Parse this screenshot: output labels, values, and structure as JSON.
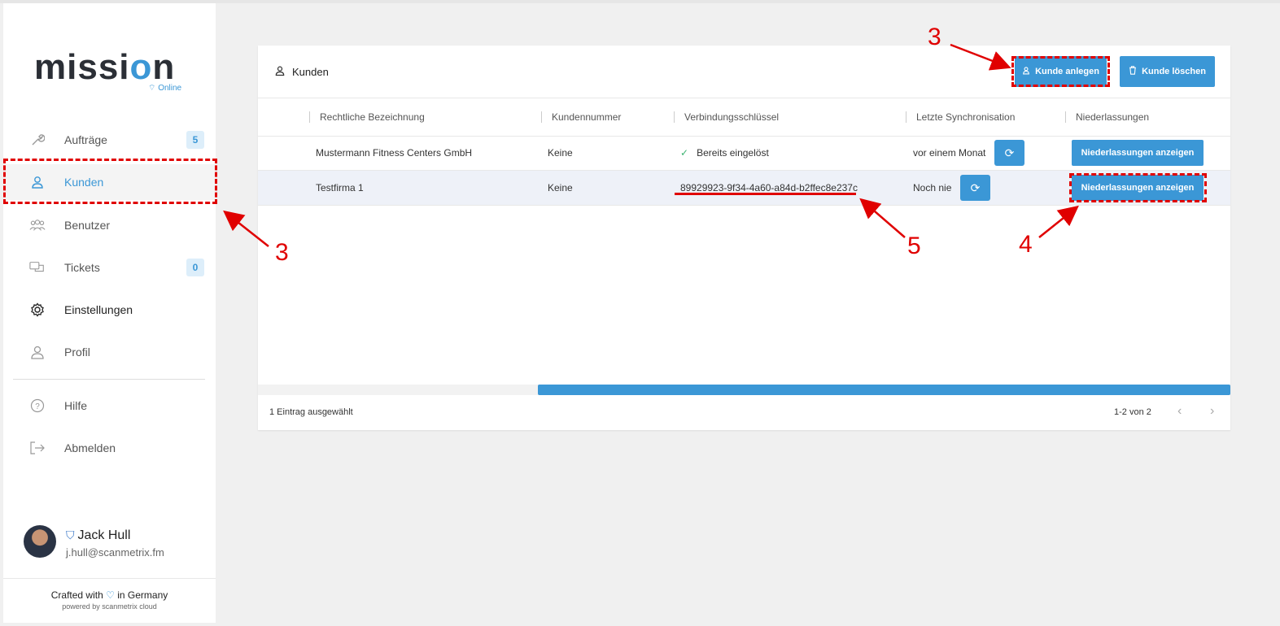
{
  "app": {
    "logo": {
      "prefix": "missi",
      "o": "o",
      "suffix": "n"
    },
    "status": "Online"
  },
  "sidebar": {
    "items": [
      {
        "label": "Aufträge",
        "icon": "wrench-icon",
        "badge": "5"
      },
      {
        "label": "Kunden",
        "icon": "customer-icon"
      },
      {
        "label": "Benutzer",
        "icon": "users-icon"
      },
      {
        "label": "Tickets",
        "icon": "chat-icon",
        "badge": "0"
      },
      {
        "label": "Einstellungen",
        "icon": "gear-icon"
      },
      {
        "label": "Profil",
        "icon": "user-icon"
      },
      {
        "label": "Hilfe",
        "icon": "help-icon"
      },
      {
        "label": "Abmelden",
        "icon": "logout-icon"
      }
    ],
    "user": {
      "name": "Jack Hull",
      "email": "j.hull@scanmetrix.fm"
    },
    "footer": {
      "crafted_pre": "Crafted with",
      "crafted_post": "in Germany",
      "powered": "powered by scanmetrix cloud"
    }
  },
  "card": {
    "title": "Kunden",
    "create_button": "Kunde anlegen",
    "delete_button": "Kunde löschen",
    "columns": [
      "Rechtliche Bezeichnung",
      "Kundennummer",
      "Verbindungsschlüssel",
      "Letzte Synchronisation",
      "Niederlassungen"
    ],
    "rows": [
      {
        "name": "Mustermann Fitness Centers GmbH",
        "number": "Keine",
        "key": "Bereits eingelöst",
        "sync": "vor einem Monat",
        "branch_button": "Niederlassungen anzeigen"
      },
      {
        "name": "Testfirma 1",
        "number": "Keine",
        "key": "89929923-9f34-4a60-a84d-b2ffec8e237c",
        "sync": "Noch nie",
        "branch_button": "Niederlassungen anzeigen"
      }
    ],
    "selected_info": "1 Eintrag ausgewählt",
    "pagination": "1-2 von 2"
  },
  "annotations": {
    "label_create": "3",
    "label_sidebar": "3",
    "label_branch": "4",
    "label_key": "5"
  },
  "colors": {
    "accent": "#3b97d6",
    "annotation": "#e00000"
  }
}
